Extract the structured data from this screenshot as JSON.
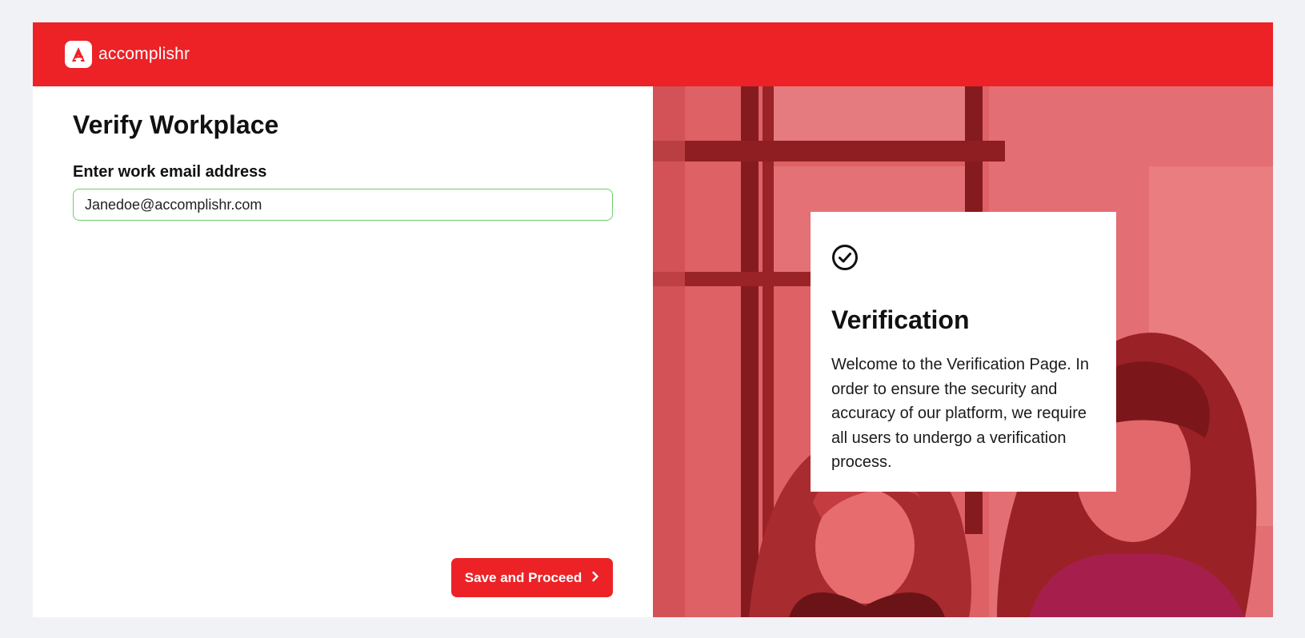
{
  "app": {
    "brand_name": "accomplishr",
    "brand_color": "#ec2227"
  },
  "form": {
    "title": "Verify Workplace",
    "email_label": "Enter work email address",
    "email_value": "Janedoe@accomplishr.com",
    "submit_label": "Save and Proceed",
    "submit_icon": "chevron-right-icon",
    "input_border_color": "#6cd06c"
  },
  "info_card": {
    "icon": "check-circle-icon",
    "title": "Verification",
    "body": "Welcome to the Verification Page. In order to ensure the security and accuracy of our platform, we require all users to undergo a verification process."
  },
  "hero": {
    "overlay_color": "#ec2227"
  }
}
